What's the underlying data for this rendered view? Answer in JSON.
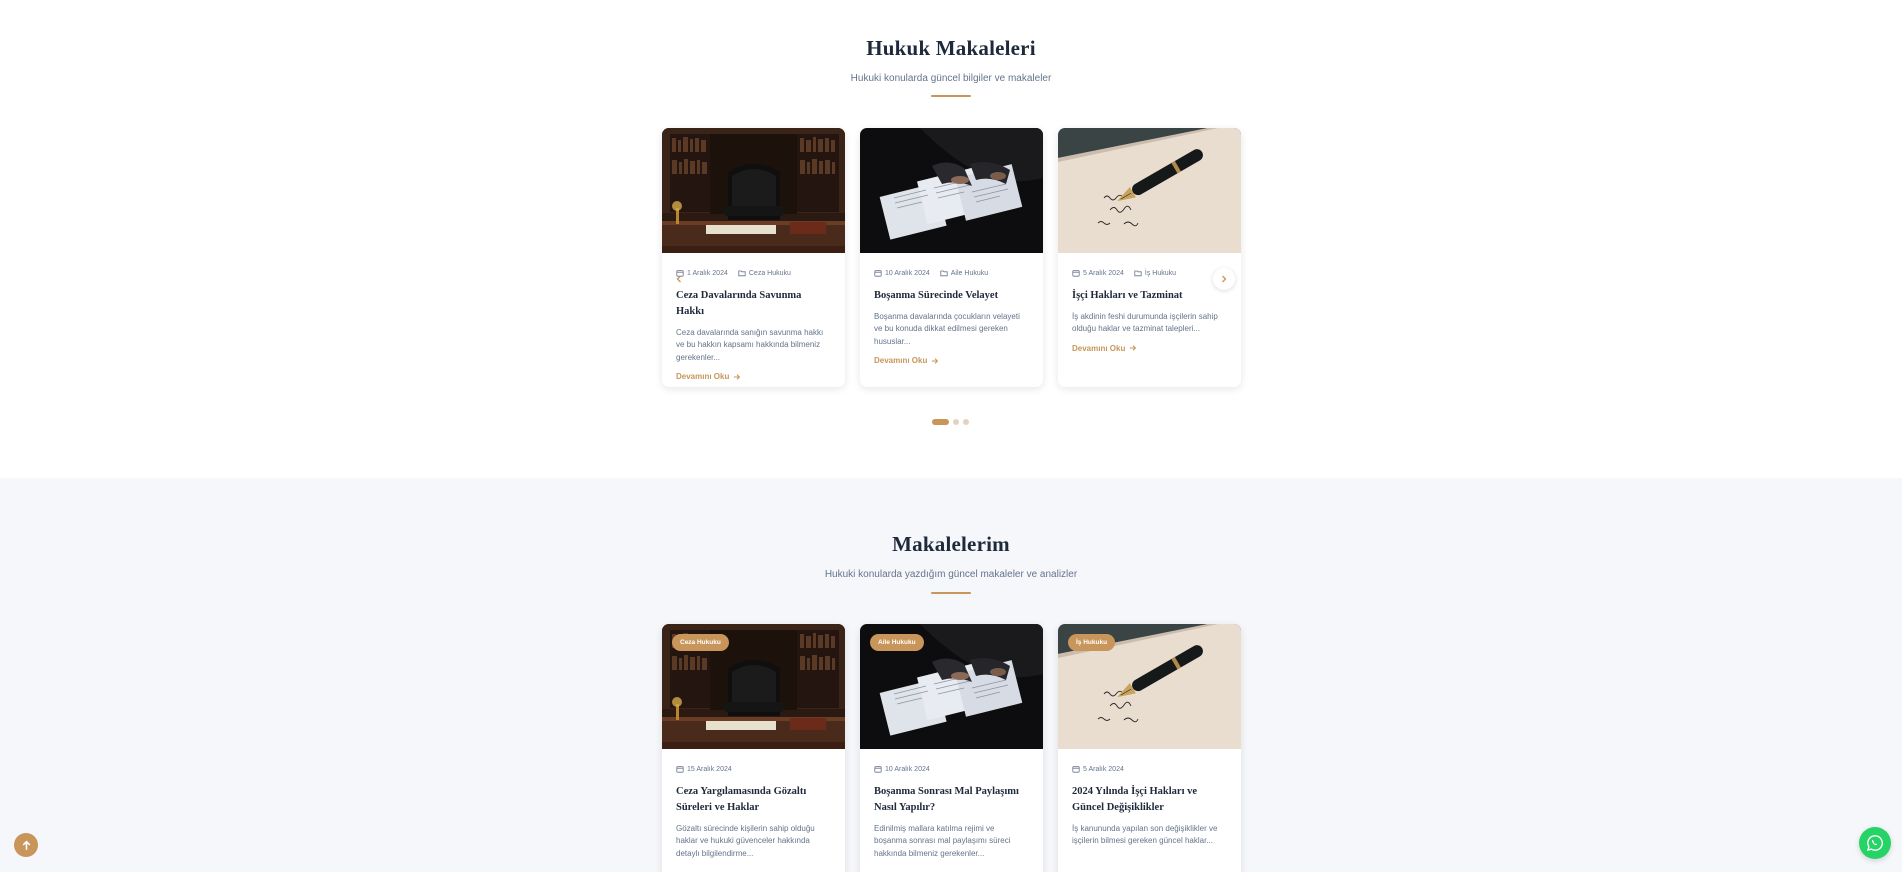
{
  "articles_section": {
    "title": "Hukuk Makaleleri",
    "subtitle": "Hukuki konularda güncel bilgiler ve makaleler",
    "cards": [
      {
        "date": "1 Aralık 2024",
        "category": "Ceza Hukuku",
        "title": "Ceza Davalarında Savunma Hakkı",
        "excerpt": "Ceza davalarında sanığın savunma hakkı ve bu hakkın kapsamı hakkında bilmeniz gerekenler...",
        "read_more": "Devamını Oku",
        "image": "office-chair-library"
      },
      {
        "date": "10 Aralık 2024",
        "category": "Aile Hukuku",
        "title": "Boşanma Sürecinde Velayet",
        "excerpt": "Boşanma davalarında çocukların velayeti ve bu konuda dikkat edilmesi gereken hususlar...",
        "read_more": "Devamını Oku",
        "image": "documents-signing"
      },
      {
        "date": "5 Aralık 2024",
        "category": "İş Hukuku",
        "title": "İşçi Hakları ve Tazminat",
        "excerpt": "İş akdinin feshi durumunda işçilerin sahip olduğu haklar ve tazminat talepleri...",
        "read_more": "Devamını Oku",
        "image": "fountain-pen-paper"
      }
    ],
    "slides": 3,
    "active_slide": 1
  },
  "my_articles_section": {
    "title": "Makalelerim",
    "subtitle": "Hukuki konularda yazdığım güncel makaleler ve analizler",
    "cards": [
      {
        "badge": "Ceza Hukuku",
        "date": "15 Aralık 2024",
        "title": "Ceza Yargılamasında Gözaltı Süreleri ve Haklar",
        "excerpt": "Gözaltı sürecinde kişilerin sahip olduğu haklar ve hukuki güvenceler hakkında detaylı bilgilendirme...",
        "image": "office-chair-library"
      },
      {
        "badge": "Aile Hukuku",
        "date": "10 Aralık 2024",
        "title": "Boşanma Sonrası Mal Paylaşımı Nasıl Yapılır?",
        "excerpt": "Edinilmiş mallara katılma rejimi ve boşanma sonrası mal paylaşımı süreci hakkında bilmeniz gerekenler...",
        "image": "documents-signing"
      },
      {
        "badge": "İş Hukuku",
        "date": "5 Aralık 2024",
        "title": "2024 Yılında İşçi Hakları ve Güncel Değişiklikler",
        "excerpt": "İş kanununda yapılan son değişiklikler ve işçilerin bilmesi gereken güncel haklar...",
        "image": "fountain-pen-paper"
      }
    ]
  },
  "colors": {
    "accent": "#c8955a",
    "whatsapp": "#25d366",
    "title": "#1e293b",
    "muted": "#64748b"
  },
  "floating": {
    "scroll_top_icon": "arrow-up-icon",
    "whatsapp_icon": "whatsapp-icon"
  }
}
